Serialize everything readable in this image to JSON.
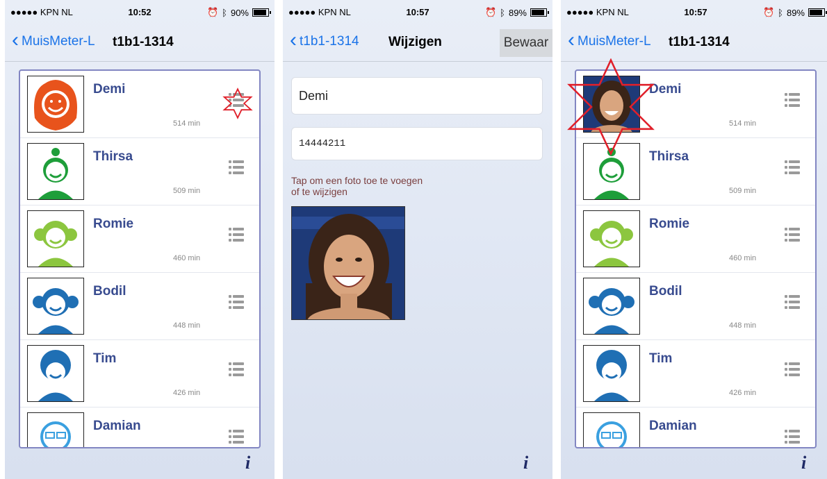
{
  "left": {
    "status": {
      "carrier": "●●●●● KPN NL",
      "time": "10:52",
      "battery": "90%",
      "battery_level": 0.9
    },
    "nav": {
      "back": "MuisMeter-L",
      "title": "t1b1-1314"
    },
    "rows": [
      {
        "name": "Demi",
        "mins": "514 min",
        "avatar": "girl-orange-icon"
      },
      {
        "name": "Thirsa",
        "mins": "509 min",
        "avatar": "girl-green-icon"
      },
      {
        "name": "Romie",
        "mins": "460 min",
        "avatar": "girl-lime-icon"
      },
      {
        "name": "Bodil",
        "mins": "448 min",
        "avatar": "girl-blue-icon"
      },
      {
        "name": "Tim",
        "mins": "426 min",
        "avatar": "boy-blue-icon"
      },
      {
        "name": "Damian",
        "mins": "",
        "avatar": "boy-glasses-icon"
      }
    ]
  },
  "middle": {
    "status": {
      "carrier": "●●●●● KPN NL",
      "time": "10:57",
      "battery": "89%",
      "battery_level": 0.89
    },
    "nav": {
      "back": "t1b1-1314",
      "title": "Wijzigen",
      "save": "Bewaar"
    },
    "form": {
      "name": "Demi",
      "code": "14444211",
      "hint": "Tap om een foto toe te voegen of te wijzigen"
    }
  },
  "right": {
    "status": {
      "carrier": "●●●●● KPN NL",
      "time": "10:57",
      "battery": "89%",
      "battery_level": 0.89
    },
    "nav": {
      "back": "MuisMeter-L",
      "title": "t1b1-1314"
    },
    "rows": [
      {
        "name": "Demi",
        "mins": "514 min",
        "avatar": "photo-icon"
      },
      {
        "name": "Thirsa",
        "mins": "509 min",
        "avatar": "girl-green-icon"
      },
      {
        "name": "Romie",
        "mins": "460 min",
        "avatar": "girl-lime-icon"
      },
      {
        "name": "Bodil",
        "mins": "448 min",
        "avatar": "girl-blue-icon"
      },
      {
        "name": "Tim",
        "mins": "426 min",
        "avatar": "boy-blue-icon"
      },
      {
        "name": "Damian",
        "mins": "",
        "avatar": "boy-glasses-icon"
      }
    ]
  },
  "colors": {
    "link": "#1a73e8",
    "name": "#384b8f",
    "list_border": "#8286c2",
    "star": "#e0202a",
    "hint": "#7a3e3e"
  }
}
